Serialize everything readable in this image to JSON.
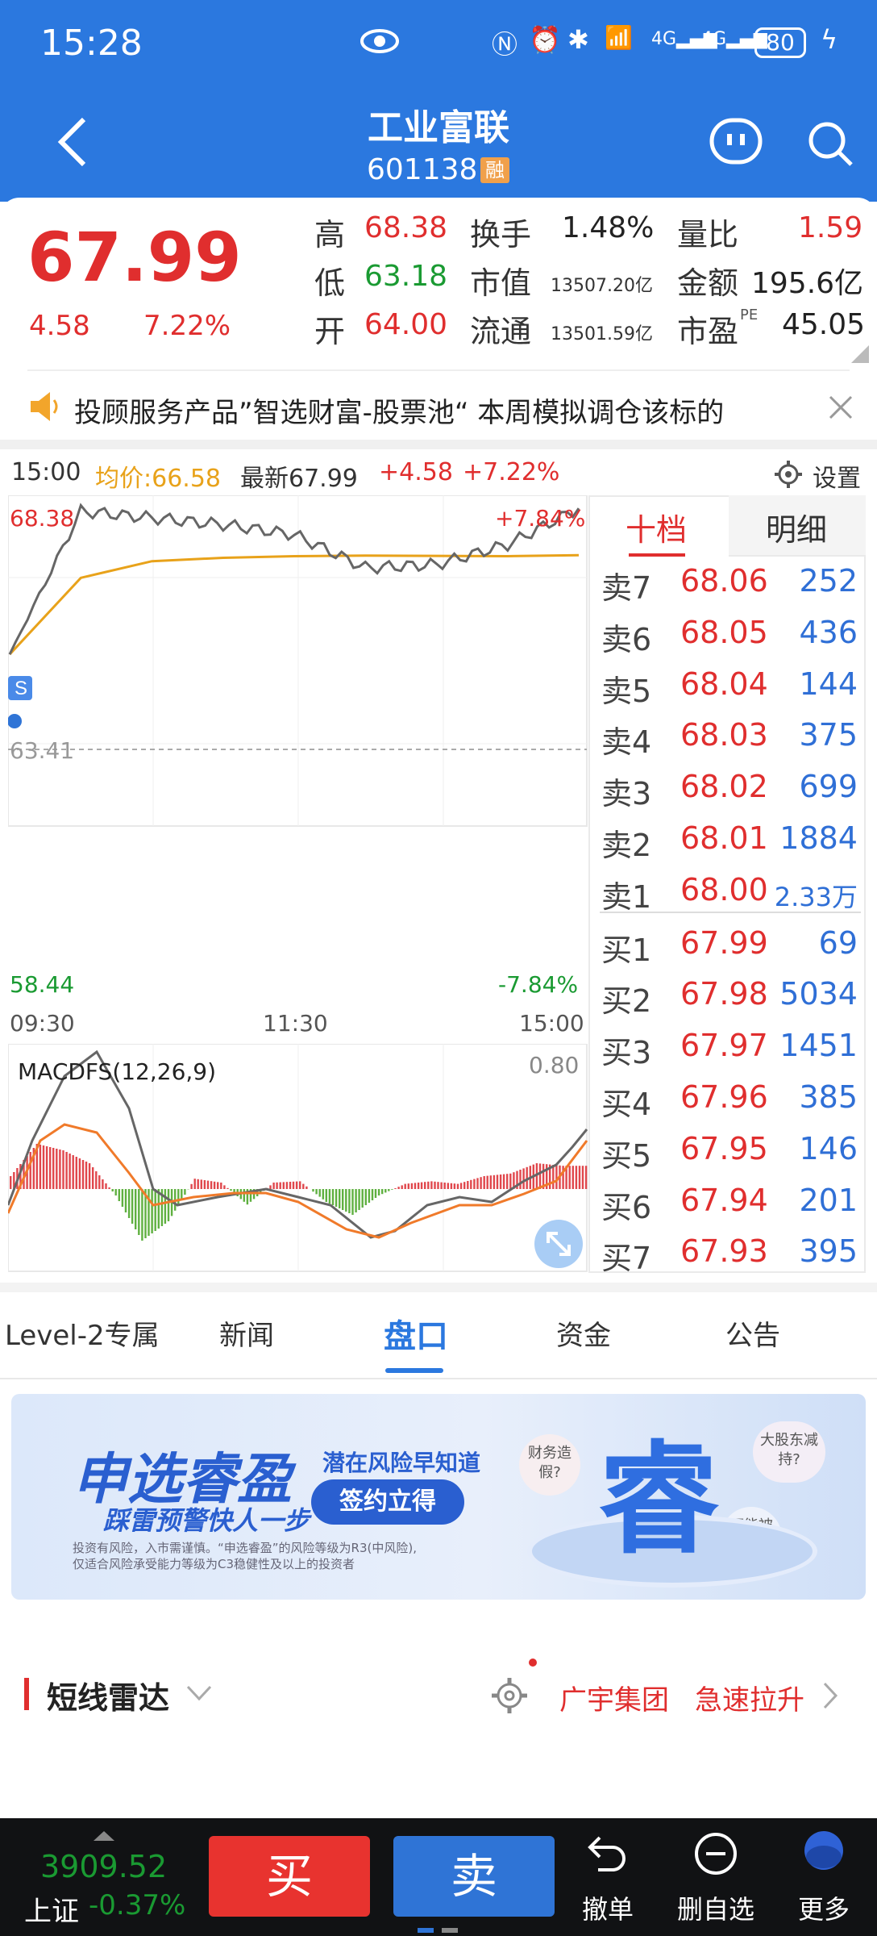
{
  "status_bar": {
    "time": "15:28",
    "battery": "80"
  },
  "nav": {
    "title": "工业富联",
    "code": "601138",
    "margin_badge": "融"
  },
  "quote": {
    "price": "67.99",
    "change": "4.58",
    "change_pct": "7.22%",
    "high_label": "高",
    "high": "68.38",
    "low_label": "低",
    "low": "63.18",
    "open_label": "开",
    "open": "64.00",
    "turnover_label": "换手",
    "turnover": "1.48%",
    "mktcap_label": "市值",
    "mktcap": "13507.20亿",
    "float_label": "流通",
    "float_cap": "13501.59亿",
    "volratio_label": "量比",
    "volratio": "1.59",
    "amount_label": "金额",
    "amount": "195.6亿",
    "pe_label": "市盈",
    "pe_sup": "PE",
    "pe": "45.05"
  },
  "notice": {
    "text": "投顾服务产品”智选财富-股票池“ 本周模拟调仓该标的"
  },
  "chart_header": {
    "time": "15:00",
    "avg": "均价:66.58",
    "latest": "最新67.99",
    "chg": "+4.58",
    "pct": "+7.22%",
    "settings": "设置"
  },
  "chart_data": [
    {
      "type": "line",
      "x": [
        "09:30",
        "10:00",
        "10:30",
        "11:00",
        "11:30",
        "13:30",
        "14:00",
        "14:30",
        "15:00"
      ],
      "series": [
        {
          "name": "",
          "values": [
            63.6,
            67.9,
            67.7,
            67.5,
            67.2,
            66.2,
            66.3,
            66.9,
            67.99
          ]
        },
        {
          "name": "均价",
          "values": [
            63.6,
            65.9,
            66.4,
            66.5,
            66.55,
            66.57,
            66.56,
            66.55,
            66.58
          ]
        }
      ],
      "ylim": [
        58.44,
        68.38
      ],
      "prev_close": "63.41",
      "y_top_label": "68.38",
      "y_bottom_label": "58.44",
      "pct_top": "+7.84%",
      "pct_bottom": "-7.84%",
      "x_ticks": [
        "09:30",
        "11:30",
        "15:00"
      ],
      "grid": true
    },
    {
      "type": "bar",
      "title": "MACDFS(12,26,9)",
      "top_label": "0.80",
      "values": [
        0.1,
        0.35,
        0.3,
        0.2,
        -0.05,
        -0.4,
        -0.25,
        0.08,
        0.05,
        -0.12,
        0.05,
        0.06,
        -0.1,
        -0.2,
        -0.05,
        0.04,
        0.06,
        0.04,
        0.1,
        0.12,
        0.2,
        0.18
      ]
    }
  ],
  "order_book": {
    "tabs": [
      "十档",
      "明细"
    ],
    "asks": [
      {
        "label": "卖7",
        "price": "68.06",
        "vol": "252"
      },
      {
        "label": "卖6",
        "price": "68.05",
        "vol": "436"
      },
      {
        "label": "卖5",
        "price": "68.04",
        "vol": "144"
      },
      {
        "label": "卖4",
        "price": "68.03",
        "vol": "375"
      },
      {
        "label": "卖3",
        "price": "68.02",
        "vol": "699"
      },
      {
        "label": "卖2",
        "price": "68.01",
        "vol": "1884"
      },
      {
        "label": "卖1",
        "price": "68.00",
        "vol": "2.33万"
      }
    ],
    "bids": [
      {
        "label": "买1",
        "price": "67.99",
        "vol": "69"
      },
      {
        "label": "买2",
        "price": "67.98",
        "vol": "5034"
      },
      {
        "label": "买3",
        "price": "67.97",
        "vol": "1451"
      },
      {
        "label": "买4",
        "price": "67.96",
        "vol": "385"
      },
      {
        "label": "买5",
        "price": "67.95",
        "vol": "146"
      },
      {
        "label": "买6",
        "price": "67.94",
        "vol": "201"
      },
      {
        "label": "买7",
        "price": "67.93",
        "vol": "395"
      }
    ]
  },
  "tabs": [
    "Level-2专属",
    "新闻",
    "盘口",
    "资金",
    "公告"
  ],
  "banner": {
    "title": "申选睿盈",
    "subtitle": "踩雷预警快人一步",
    "tagline": "潜在风险早知道",
    "cta": "签约立得",
    "disclaimer1": "投资有风险，入市需谨慎。“申选睿盈”的风险等级为R3(中风险),",
    "disclaimer2": "仅适合风险承受能力等级为C3稳健性及以上的投资者",
    "tag1": "财务造假?",
    "tag2": "大股东减持?",
    "tag3": "可能被ST?",
    "hero": "睿"
  },
  "radar": {
    "title": "短线雷达",
    "item1": "广宇集团",
    "item2": "急速拉升"
  },
  "bottom": {
    "index_value": "3909.52",
    "index_name": "上证",
    "index_pct": "-0.37%",
    "buy": "买",
    "sell": "卖",
    "cancel": "撤单",
    "del_watch": "删自选",
    "more": "更多"
  }
}
